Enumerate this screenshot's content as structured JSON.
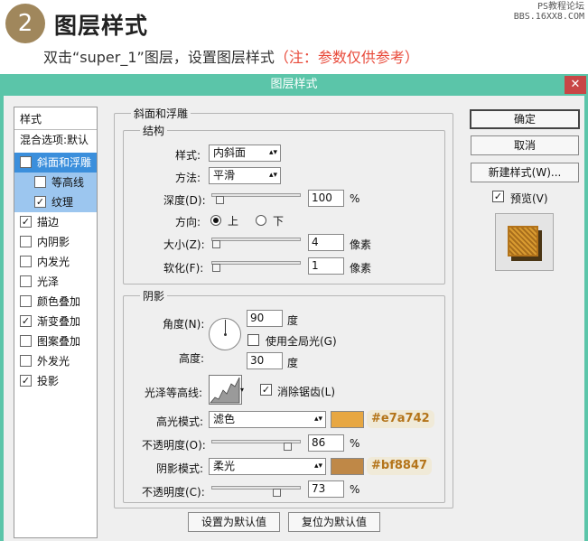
{
  "header": {
    "step_number": "2",
    "step_title": "图层样式",
    "desc_main": "双击“super_1”图层，设置图层样式",
    "desc_note": "（注：参数仅供参考）",
    "watermark_line1": "PS教程论坛",
    "watermark_line2": "BBS.16XX8.COM"
  },
  "dialog": {
    "title": "图层样式",
    "close_label": "✕",
    "left_panel": {
      "heading": "样式",
      "blend_options": "混合选项:默认",
      "items": [
        {
          "label": "斜面和浮雕",
          "checked": true
        },
        {
          "label": "等高线",
          "checked": false
        },
        {
          "label": "纹理",
          "checked": true
        },
        {
          "label": "描边",
          "checked": true
        },
        {
          "label": "内阴影",
          "checked": false
        },
        {
          "label": "内发光",
          "checked": false
        },
        {
          "label": "光泽",
          "checked": false
        },
        {
          "label": "颜色叠加",
          "checked": false
        },
        {
          "label": "渐变叠加",
          "checked": true
        },
        {
          "label": "图案叠加",
          "checked": false
        },
        {
          "label": "外发光",
          "checked": false
        },
        {
          "label": "投影",
          "checked": true
        }
      ]
    },
    "bevel": {
      "section_title": "斜面和浮雕",
      "structure_title": "结构",
      "style_label": "样式:",
      "style_value": "内斜面",
      "method_label": "方法:",
      "method_value": "平滑",
      "depth_label": "深度(D):",
      "depth_value": "100",
      "depth_unit": "%",
      "direction_label": "方向:",
      "direction_up": "上",
      "direction_down": "下",
      "size_label": "大小(Z):",
      "size_value": "4",
      "size_unit": "像素",
      "soften_label": "软化(F):",
      "soften_value": "1",
      "soften_unit": "像素",
      "shading_title": "阴影",
      "angle_label": "角度(N):",
      "angle_value": "90",
      "angle_unit": "度",
      "global_light_label": "使用全局光(G)",
      "altitude_label": "高度:",
      "altitude_value": "30",
      "altitude_unit": "度",
      "gloss_label": "光泽等高线:",
      "antialias_label": "消除锯齿(L)",
      "highlight_mode_label": "高光模式:",
      "highlight_mode_value": "滤色",
      "highlight_color": "#e7a742",
      "highlight_hex": "#e7a742",
      "highlight_opacity_label": "不透明度(O):",
      "highlight_opacity_value": "86",
      "shadow_mode_label": "阴影模式:",
      "shadow_mode_value": "柔光",
      "shadow_color": "#bf8847",
      "shadow_hex": "#bf8847",
      "shadow_opacity_label": "不透明度(C):",
      "shadow_opacity_value": "73",
      "percent": "%",
      "make_default": "设置为默认值",
      "reset_default": "复位为默认值"
    },
    "buttons": {
      "ok": "确定",
      "cancel": "取消",
      "new_style": "新建样式(W)...",
      "preview": "预览(V)"
    }
  }
}
